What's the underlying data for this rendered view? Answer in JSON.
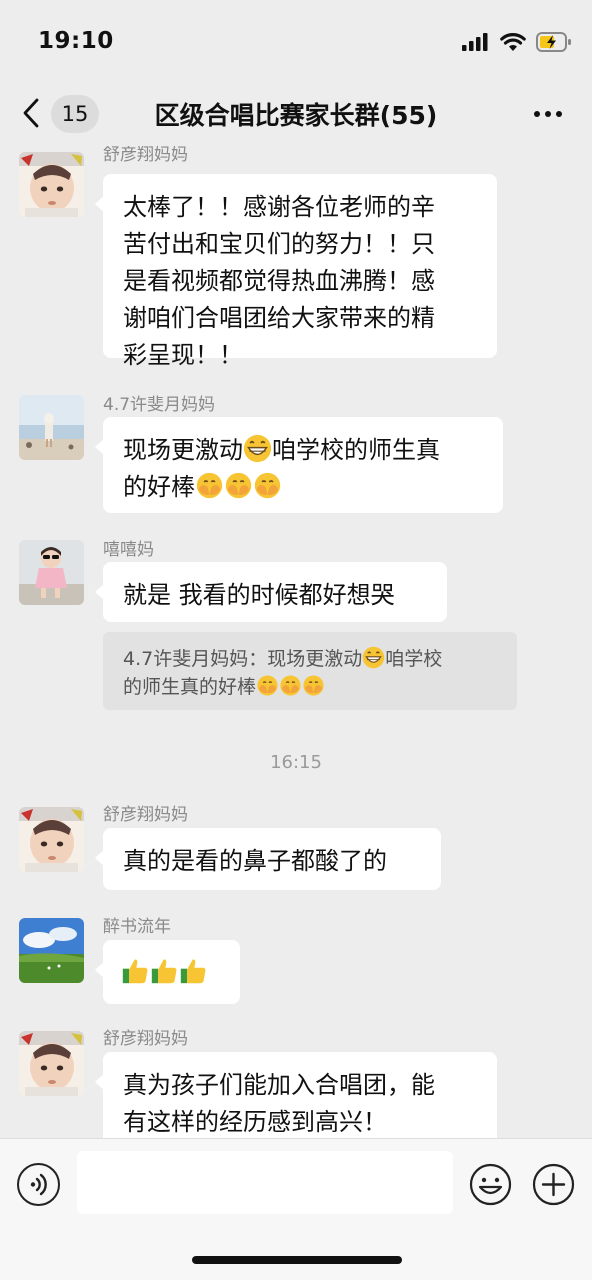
{
  "status": {
    "time": "19:10"
  },
  "nav": {
    "unread": "15",
    "title": "区级合唱比赛家长群(55)"
  },
  "messages": [
    {
      "sender": "舒彦翔妈妈",
      "lines": [
        "太棒了！！感谢各位老师的辛",
        "苦付出和宝贝们的努力！！只",
        "是看视频都觉得热血沸腾！感",
        "谢咱们合唱团给大家带来的精",
        "彩呈现！！"
      ]
    },
    {
      "sender": "4.7许斐月妈妈",
      "line1_a": "现场更激动",
      "line1_b": "咱学校的师生真",
      "line2": "的好棒"
    },
    {
      "sender": "嘻嘻妈",
      "text": "就是 我看的时候都好想哭",
      "quote_a": "4.7许斐月妈妈：现场更激动",
      "quote_b": "咱学校",
      "quote_c": "的师生真的好棒"
    },
    {
      "sender": "舒彦翔妈妈",
      "text": "真的是看的鼻子都酸了的"
    },
    {
      "sender": "醉书流年"
    },
    {
      "sender": "舒彦翔妈妈",
      "lines": [
        "真为孩子们能加入合唱团，能",
        "有这样的经历感到高兴！"
      ]
    }
  ],
  "time_separator": "16:15",
  "colors": {
    "background": "#ededed",
    "bubble": "#ffffff",
    "quote": "#e2e2e2",
    "meta_text": "#8a8a8a",
    "battery_charging": "#f5c518"
  },
  "icons": [
    "chevron-left-icon",
    "more-icon",
    "voice-icon",
    "emoji-icon",
    "plus-icon",
    "grin-emoji",
    "facepalm-emoji",
    "thumbs-up-emoji"
  ]
}
